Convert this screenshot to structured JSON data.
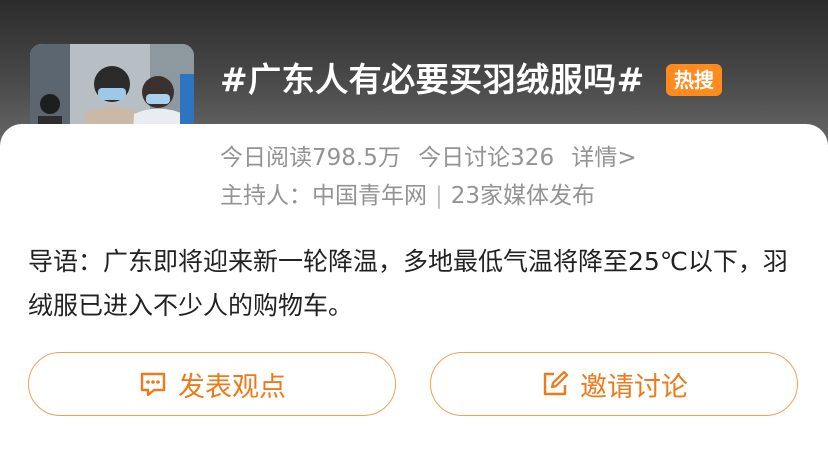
{
  "topic": {
    "title": "#广东人有必要买羽绒服吗#",
    "badge": "热搜"
  },
  "stats": {
    "reads": "今日阅读798.5万",
    "discussions": "今日讨论326",
    "details": "详情>"
  },
  "host": {
    "label": "主持人：中国青年网",
    "separator": "|",
    "media": "23家媒体发布"
  },
  "intro": {
    "text": "导语：广东即将迎来新一轮降温，多地最低气温将降至25℃以下，羽绒服已进入不少人的购物车。"
  },
  "actions": {
    "comment_label": "发表观点",
    "invite_label": "邀请讨论"
  },
  "colors": {
    "accent": "#ee7a1a",
    "badge_bg": "#ff8a1e",
    "muted_text": "#939393"
  },
  "icons": {
    "comment": "comment-bubble-icon",
    "invite": "edit-square-icon"
  }
}
